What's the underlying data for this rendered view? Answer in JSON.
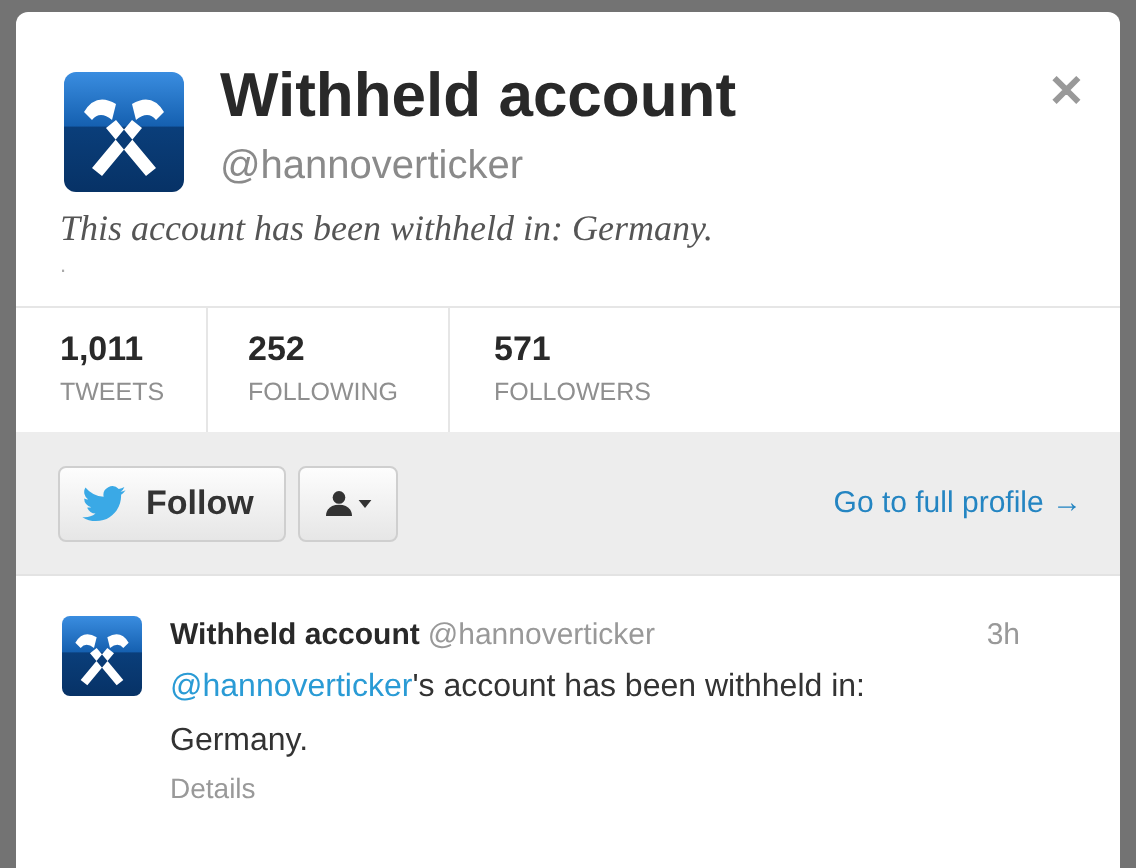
{
  "profile": {
    "name": "Withheld account",
    "handle": "@hannoverticker",
    "bio": "This account has been withheld in: Germany.",
    "location": ".",
    "close": "✕"
  },
  "stats": [
    {
      "value": "1,011",
      "label": "TWEETS"
    },
    {
      "value": "252",
      "label": "FOLLOWING"
    },
    {
      "value": "571",
      "label": "FOLLOWERS"
    }
  ],
  "actions": {
    "follow": "Follow",
    "full_profile": "Go to full profile →"
  },
  "tweet": {
    "name": "Withheld account",
    "handle": "@hannoverticker",
    "time": "3h",
    "mention": "@hannoverticker",
    "text": "'s account has been withheld in: Germany.",
    "details": "Details"
  }
}
